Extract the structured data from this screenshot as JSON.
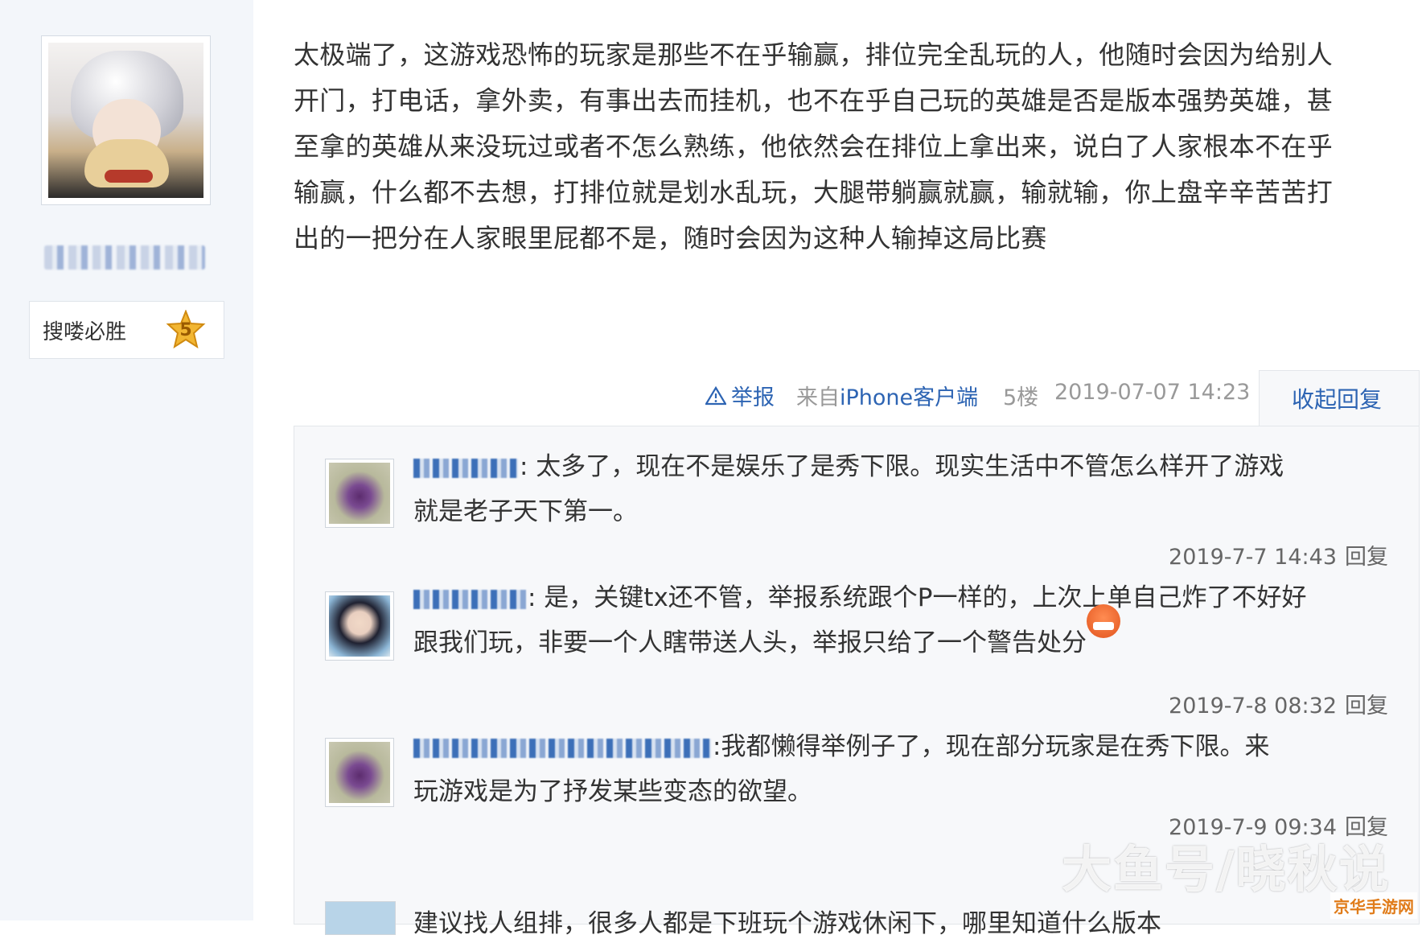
{
  "sidebar": {
    "avatar_icon": "anime-avatar",
    "badge": {
      "label": "搜喽必胜",
      "level": "5"
    }
  },
  "post": {
    "lines": [
      "太极端了，这游戏恐怖的玩家是那些不在乎输赢，排位完全乱玩的人，他随时会因为给别人",
      "开门，打电话，拿外卖，有事出去而挂机，也不在乎自己玩的英雄是否是版本强势英雄，甚",
      "至拿的英雄从来没玩过或者不怎么熟练，他依然会在排位上拿出来，说白了人家根本不在乎",
      "输赢，什么都不去想，打排位就是划水乱玩，大腿带躺赢就赢，输就输，你上盘辛辛苦苦打",
      "出的一把分在人家眼里屁都不是，随时会因为这种人输掉这局比赛"
    ],
    "meta": {
      "report": "举报",
      "source_prefix": "来自",
      "source_device": "iPhone客户端",
      "floor": "5楼",
      "date": "2019-07-07 14:23",
      "collapse": "收起回复"
    }
  },
  "replies": [
    {
      "text_line1": ": 太多了，现在不是娱乐了是秀下限。现实生活中不管怎么样开了游戏",
      "text_line2": "就是老子天下第一。",
      "time": "2019-7-7 14:43",
      "reply_label": "回复"
    },
    {
      "text_line1": ": 是，关键tx还不管，举报系统跟个P一样的，上次上单自己炸了不好好",
      "text_line2": "跟我们玩，非要一个人瞎带送人头，举报只给了一个警告处分",
      "time": "2019-7-8 08:32",
      "reply_label": "回复"
    },
    {
      "text_line1": ":我都懒得举例子了，现在部分玩家是在秀下限。来",
      "text_line2": "玩游戏是为了抒发某些变态的欲望。",
      "time": "2019-7-9 09:34",
      "reply_label": "回复"
    }
  ],
  "partial_reply": "建议找人组排，很多人都是下班玩个游戏休闲下，哪里知道什么版本",
  "watermark": "大鱼号/晓秋说",
  "corner_logo": "京华手游网",
  "colors": {
    "link": "#2d64b3",
    "sidebar_bg": "#f3f6fa",
    "reply_bg": "#f7f8fa"
  }
}
